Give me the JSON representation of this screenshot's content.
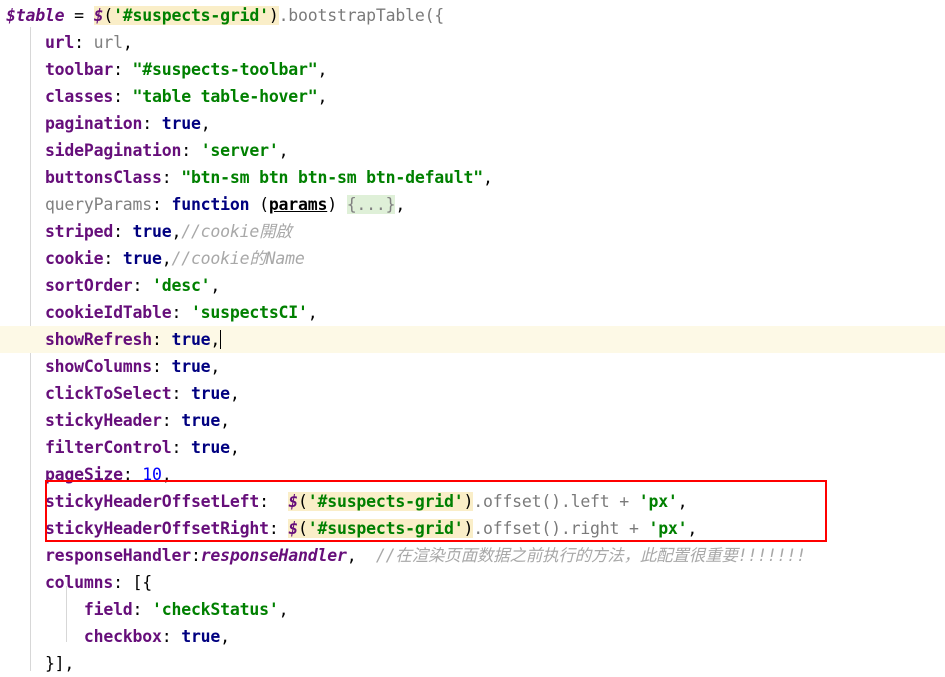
{
  "editor": {
    "language": "javascript",
    "caret_line_index": 12,
    "colors": {
      "background": "#ffffff",
      "current_line_highlight": "#fdf9e6",
      "search_highlight": "#faeec8",
      "folded_region_highlight": "#dff0d8",
      "annotation_box": "#ff0000",
      "property_key": "#660e7a",
      "keyword": "#000080",
      "string": "#008000",
      "number": "#0000ff",
      "comment": "#a8a8a8",
      "dimmed_identifier": "#808080",
      "indent_guide": "#d7d7d7"
    },
    "annotation": {
      "name": "red-highlight-rectangle",
      "target_lines": [
        "stickyHeaderOffsetLeft",
        "stickyHeaderOffsetRight"
      ]
    },
    "lines": [
      {
        "indent": 0,
        "text": "$table = $('#suspects-grid').bootstrapTable({"
      },
      {
        "indent": 1,
        "text": "url: url,"
      },
      {
        "indent": 1,
        "text": "toolbar: \"#suspects-toolbar\","
      },
      {
        "indent": 1,
        "text": "classes: \"table table-hover\","
      },
      {
        "indent": 1,
        "text": "pagination: true,"
      },
      {
        "indent": 1,
        "text": "sidePagination: 'server',"
      },
      {
        "indent": 1,
        "text": "buttonsClass: \"btn-sm btn btn-sm btn-default\","
      },
      {
        "indent": 1,
        "text": "queryParams: function (params) {...},"
      },
      {
        "indent": 1,
        "text": "striped: true,//cookie開啟"
      },
      {
        "indent": 1,
        "text": "cookie: true,//cookie的Name"
      },
      {
        "indent": 1,
        "text": "sortOrder: 'desc',"
      },
      {
        "indent": 1,
        "text": "cookieIdTable: 'suspectsCI',"
      },
      {
        "indent": 1,
        "text": "showRefresh: true,"
      },
      {
        "indent": 1,
        "text": "showColumns: true,"
      },
      {
        "indent": 1,
        "text": "clickToSelect: true,"
      },
      {
        "indent": 1,
        "text": "stickyHeader: true,"
      },
      {
        "indent": 1,
        "text": "filterControl: true,"
      },
      {
        "indent": 1,
        "text": "pageSize: 10,"
      },
      {
        "indent": 1,
        "text": "stickyHeaderOffsetLeft:  $('#suspects-grid').offset().left + 'px',"
      },
      {
        "indent": 1,
        "text": "stickyHeaderOffsetRight: $('#suspects-grid').offset().right + 'px',"
      },
      {
        "indent": 1,
        "text": "responseHandler:responseHandler,  //在渲染页面数据之前执行的方法，此配置很重要!!!!!!!"
      },
      {
        "indent": 1,
        "text": "columns: [{"
      },
      {
        "indent": 2,
        "text": "field: 'checkStatus',"
      },
      {
        "indent": 2,
        "text": "checkbox: true,"
      },
      {
        "indent": 1,
        "text": "}],"
      }
    ],
    "tokens": {
      "l0": {
        "var": "$table",
        "eq": " = ",
        "call": "$('#suspects-grid')",
        "tail": ".bootstrapTable({"
      },
      "l1": {
        "key": "url",
        "val": "url"
      },
      "l2": {
        "key": "toolbar",
        "val": "\"#suspects-toolbar\""
      },
      "l3": {
        "key": "classes",
        "val": "\"table table-hover\""
      },
      "l4": {
        "key": "pagination",
        "val": "true"
      },
      "l5": {
        "key": "sidePagination",
        "val": "'server'"
      },
      "l6": {
        "key": "buttonsClass",
        "val": "\"btn-sm btn btn-sm btn-default\""
      },
      "l7": {
        "key": "queryParams",
        "fn": "function",
        "param": "params",
        "fold": "{...}"
      },
      "l8": {
        "key": "striped",
        "val": "true",
        "comment": "//cookie開啟"
      },
      "l9": {
        "key": "cookie",
        "val": "true",
        "comment": "//cookie的Name"
      },
      "l10": {
        "key": "sortOrder",
        "val": "'desc'"
      },
      "l11": {
        "key": "cookieIdTable",
        "val": "'suspectsCI'"
      },
      "l12": {
        "key": "showRefresh",
        "val": "true"
      },
      "l13": {
        "key": "showColumns",
        "val": "true"
      },
      "l14": {
        "key": "clickToSelect",
        "val": "true"
      },
      "l15": {
        "key": "stickyHeader",
        "val": "true"
      },
      "l16": {
        "key": "filterControl",
        "val": "true"
      },
      "l17": {
        "key": "pageSize",
        "val": "10"
      },
      "l18": {
        "key": "stickyHeaderOffsetLeft",
        "call": "$('#suspects-grid')",
        "mid": ".offset().left + ",
        "unit": "'px'"
      },
      "l19": {
        "key": "stickyHeaderOffsetRight",
        "call": "$('#suspects-grid')",
        "mid": ".offset().right + ",
        "unit": "'px'"
      },
      "l20": {
        "key": "responseHandler",
        "val": "responseHandler",
        "comment": "//在渲染页面数据之前执行的方法，此配置很重要!!!!!!!"
      },
      "l21": {
        "key": "columns",
        "val": "[{"
      },
      "l22": {
        "key": "field",
        "val": "'checkStatus'"
      },
      "l23": {
        "key": "checkbox",
        "val": "true"
      },
      "l24": {
        "val": "}],"
      }
    }
  }
}
